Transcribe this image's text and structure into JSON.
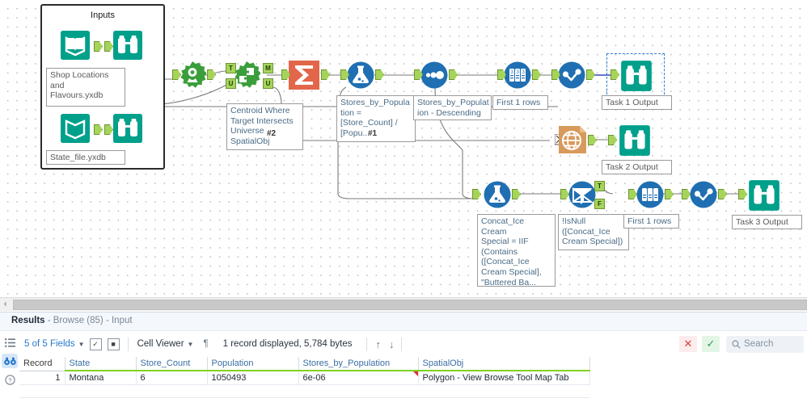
{
  "canvas": {
    "container": {
      "title": "Inputs"
    },
    "tools": [
      {
        "id": "input-shop",
        "icon": "input-data-icon",
        "label": "Shop Locations\nand\nFlavours.yxdb"
      },
      {
        "id": "browse-shop",
        "icon": "browse-icon",
        "label": ""
      },
      {
        "id": "input-state",
        "icon": "input-data-icon",
        "label": "State_file.yxdb"
      },
      {
        "id": "browse-state",
        "icon": "browse-icon",
        "label": ""
      },
      {
        "id": "poly-build",
        "icon": "create-points-icon",
        "label": ""
      },
      {
        "id": "spatial-match",
        "icon": "spatial-match-icon",
        "label": "Centroid Where\nTarget Intersects\nUniverse\nSpatialObj",
        "tag": "#2"
      },
      {
        "id": "summarize",
        "icon": "summarize-sigma-icon",
        "label": ""
      },
      {
        "id": "formula-1",
        "icon": "formula-flask-icon",
        "label": "Stores_by_Popula\ntion =\n[Store_Count] /\n[Popu...",
        "tag": "#1"
      },
      {
        "id": "sort",
        "icon": "sort-icon",
        "label": "Stores_by_Populat\nion - Descending"
      },
      {
        "id": "sample-1",
        "icon": "sample-icon",
        "label": "First 1 rows"
      },
      {
        "id": "select-1",
        "icon": "select-check-icon",
        "label": ""
      },
      {
        "id": "browse-task1",
        "icon": "browse-icon",
        "label": "Task 1 Output",
        "selected": true
      },
      {
        "id": "report-map",
        "icon": "report-map-globe-icon",
        "label": ""
      },
      {
        "id": "browse-task2",
        "icon": "browse-icon",
        "label": "Task 2 Output"
      },
      {
        "id": "formula-2",
        "icon": "formula-flask-icon",
        "label": "Concat_Ice Cream\nSpecial = IIF\n(Contains\n([Concat_Ice\nCream Special],\n\"Buttered Ba..."
      },
      {
        "id": "filter",
        "icon": "filter-funnel-icon",
        "label": "!IsNull\n([Concat_Ice\nCream Special])"
      },
      {
        "id": "sample-2",
        "icon": "sample-icon",
        "label": "First 1 rows"
      },
      {
        "id": "select-2",
        "icon": "select-check-icon",
        "label": ""
      },
      {
        "id": "browse-task3",
        "icon": "browse-icon",
        "label": "Task 3 Output"
      }
    ],
    "anchor_labels": {
      "t": "T",
      "u": "U",
      "m": "M",
      "f": "F"
    },
    "scrollbar": {
      "left_arrow": "‹"
    }
  },
  "results": {
    "title_label": "Results",
    "title_rest": " - Browse (85) - Input",
    "rail": [
      {
        "name": "list-view-icon",
        "glyph": "☰"
      },
      {
        "name": "browse-icon",
        "glyph": "⊙⊙",
        "active": true
      },
      {
        "name": "help-icon",
        "glyph": "?"
      }
    ],
    "toolbar": {
      "fields_label": "5 of 5 Fields",
      "check_all_icon": "check-box-icon",
      "uncheck_all_icon": "uncheck-box-icon",
      "cell_viewer_label": "Cell Viewer",
      "pilcrow_icon": "¶",
      "record_info": "1 record displayed, 5,784 bytes",
      "up_arrow": "↑",
      "down_arrow": "↓",
      "cancel_icon": "✕",
      "confirm_icon": "✓",
      "search_placeholder": "Search"
    },
    "table": {
      "columns": [
        "Record",
        "State",
        "Store_Count",
        "Population",
        "Stores_by_Population",
        "SpatialObj"
      ],
      "rows": [
        {
          "Record": "1",
          "State": "Montana",
          "Store_Count": "6",
          "Population": "1050493",
          "Stores_by_Population": "6e-06",
          "SpatialObj": "Polygon - View Browse Tool Map Tab"
        }
      ]
    }
  },
  "colors": {
    "teal": "#00a08b",
    "green": "#3a9e3a",
    "blue": "#1f6fb2",
    "orange_sigma": "#e2674a",
    "orange_map": "#d89a5c",
    "anchor_green": "#a6d45a",
    "header_underline": "#7ed321",
    "accent_blue": "#2878c8"
  }
}
